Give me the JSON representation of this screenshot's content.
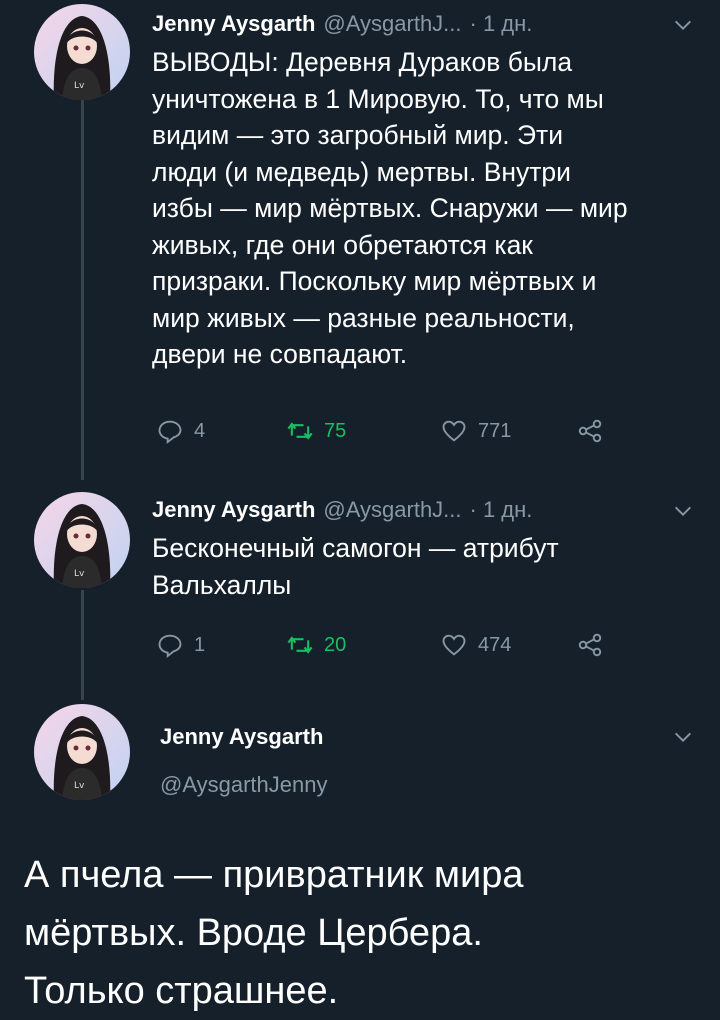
{
  "colors": {
    "background": "#15202b",
    "secondary_text": "#8899a6",
    "retweet_green": "#17bf63",
    "thread_line": "#38444d"
  },
  "tweets": [
    {
      "name": "Jenny Aysgarth",
      "handle": "@AysgarthJ...",
      "time": "· 1 дн.",
      "text": "ВЫВОДЫ: Деревня Дураков была\nуничтожена в 1 Мировую. То, что мы\nвидим — это загробный мир. Эти\nлюди (и медведь) мертвы. Внутри\nизбы — мир мёртвых. Снаружи — мир\nживых, где они обретаются как\nпризраки. Поскольку мир мёртвых и\nмир живых — разные реальности,\nдвери не совпадают.",
      "replies": "4",
      "retweets": "75",
      "likes": "771"
    },
    {
      "name": "Jenny Aysgarth",
      "handle": "@AysgarthJ...",
      "time": "· 1 дн.",
      "text": "Бесконечный самогон — атрибут\nВальхаллы",
      "replies": "1",
      "retweets": "20",
      "likes": "474"
    }
  ],
  "main_tweet": {
    "name": "Jenny Aysgarth",
    "handle": "@AysgarthJenny",
    "text": "А пчела — привратник мира\nмёртвых. Вроде Цербера.\nТолько страшнее."
  },
  "icons": {
    "reply": "reply-icon",
    "retweet": "retweet-icon",
    "like": "heart-icon",
    "share": "share-icon",
    "menu": "chevron-down-icon"
  }
}
